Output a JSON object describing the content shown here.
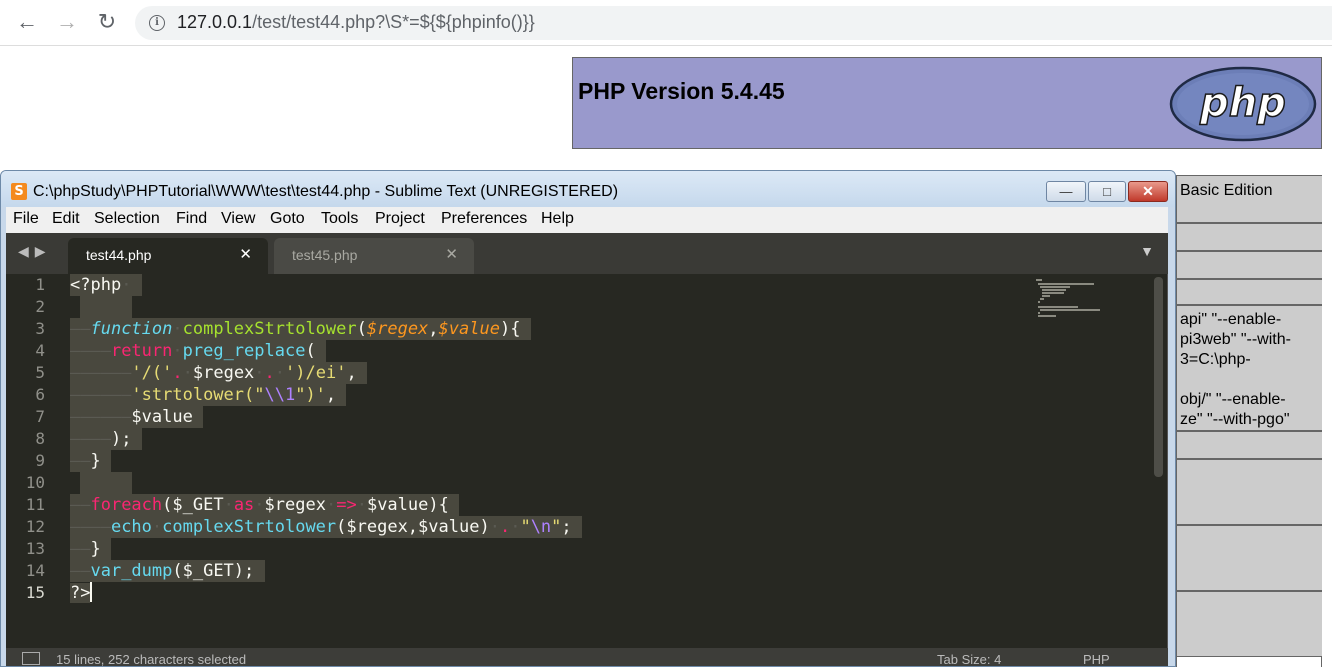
{
  "browser": {
    "back_icon": "arrow-left-icon",
    "forward_icon": "arrow-right-icon",
    "reload_icon": "reload-icon",
    "info_icon": "info-icon",
    "url_host": "127.0.0.1",
    "url_path": "/test/test44.php?\\S*=${${phpinfo()}}"
  },
  "phpinfo": {
    "version_title": "PHP Version 5.4.45",
    "logo_text": "php",
    "rows": [
      {
        "text": "Basic Edition"
      },
      {
        "text": ""
      },
      {
        "text": ""
      },
      {
        "text": ""
      },
      {
        "text": "api\" \"--enable-"
      },
      {
        "text": "pi3web\" \"--with-"
      },
      {
        "text": "3=C:\\php-"
      },
      {
        "text": ""
      },
      {
        "text": "obj/\" \"--enable-"
      },
      {
        "text": "ze\" \"--with-pgo\""
      }
    ]
  },
  "sublime": {
    "window_title": "C:\\phpStudy\\PHPTutorial\\WWW\\test\\test44.php - Sublime Text (UNREGISTERED)",
    "app_icon": "sublime-logo-icon",
    "window_buttons": {
      "minimize": "minimize-icon",
      "maximize": "maximize-icon",
      "close": "close-icon"
    },
    "menu": [
      "File",
      "Edit",
      "Selection",
      "Find",
      "View",
      "Goto",
      "Tools",
      "Project",
      "Preferences",
      "Help"
    ],
    "tabs": [
      {
        "label": "test44.php",
        "active": true
      },
      {
        "label": "test45.php",
        "active": false
      }
    ],
    "line_numbers": [
      "1",
      "2",
      "3",
      "4",
      "5",
      "6",
      "7",
      "8",
      "9",
      "10",
      "11",
      "12",
      "13",
      "14",
      "15"
    ],
    "status_text": "15 lines, 252 characters selected",
    "tab_size": "Tab Size: 4",
    "syntax": "PHP"
  },
  "colors": {
    "php_header_bg": "#9999cc",
    "editor_bg": "#272822",
    "selection": "#49483e",
    "keyword": "#f92672",
    "function": "#a6e22e",
    "string": "#e6db74",
    "storage": "#66d9ef",
    "parameter": "#fd971f"
  }
}
